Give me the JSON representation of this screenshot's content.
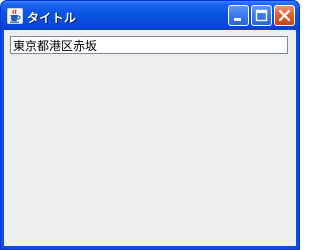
{
  "window": {
    "title": "タイトル",
    "controls": {
      "minimize_icon": "minimize-icon",
      "maximize_icon": "maximize-icon",
      "close_icon": "close-icon"
    },
    "app_icon": "java-cup-icon"
  },
  "form": {
    "address_value": "東京都港区赤坂"
  },
  "colors": {
    "titlebar": "#0a55e6",
    "client_background": "#eeeeee",
    "close_button": "#e2602e"
  }
}
